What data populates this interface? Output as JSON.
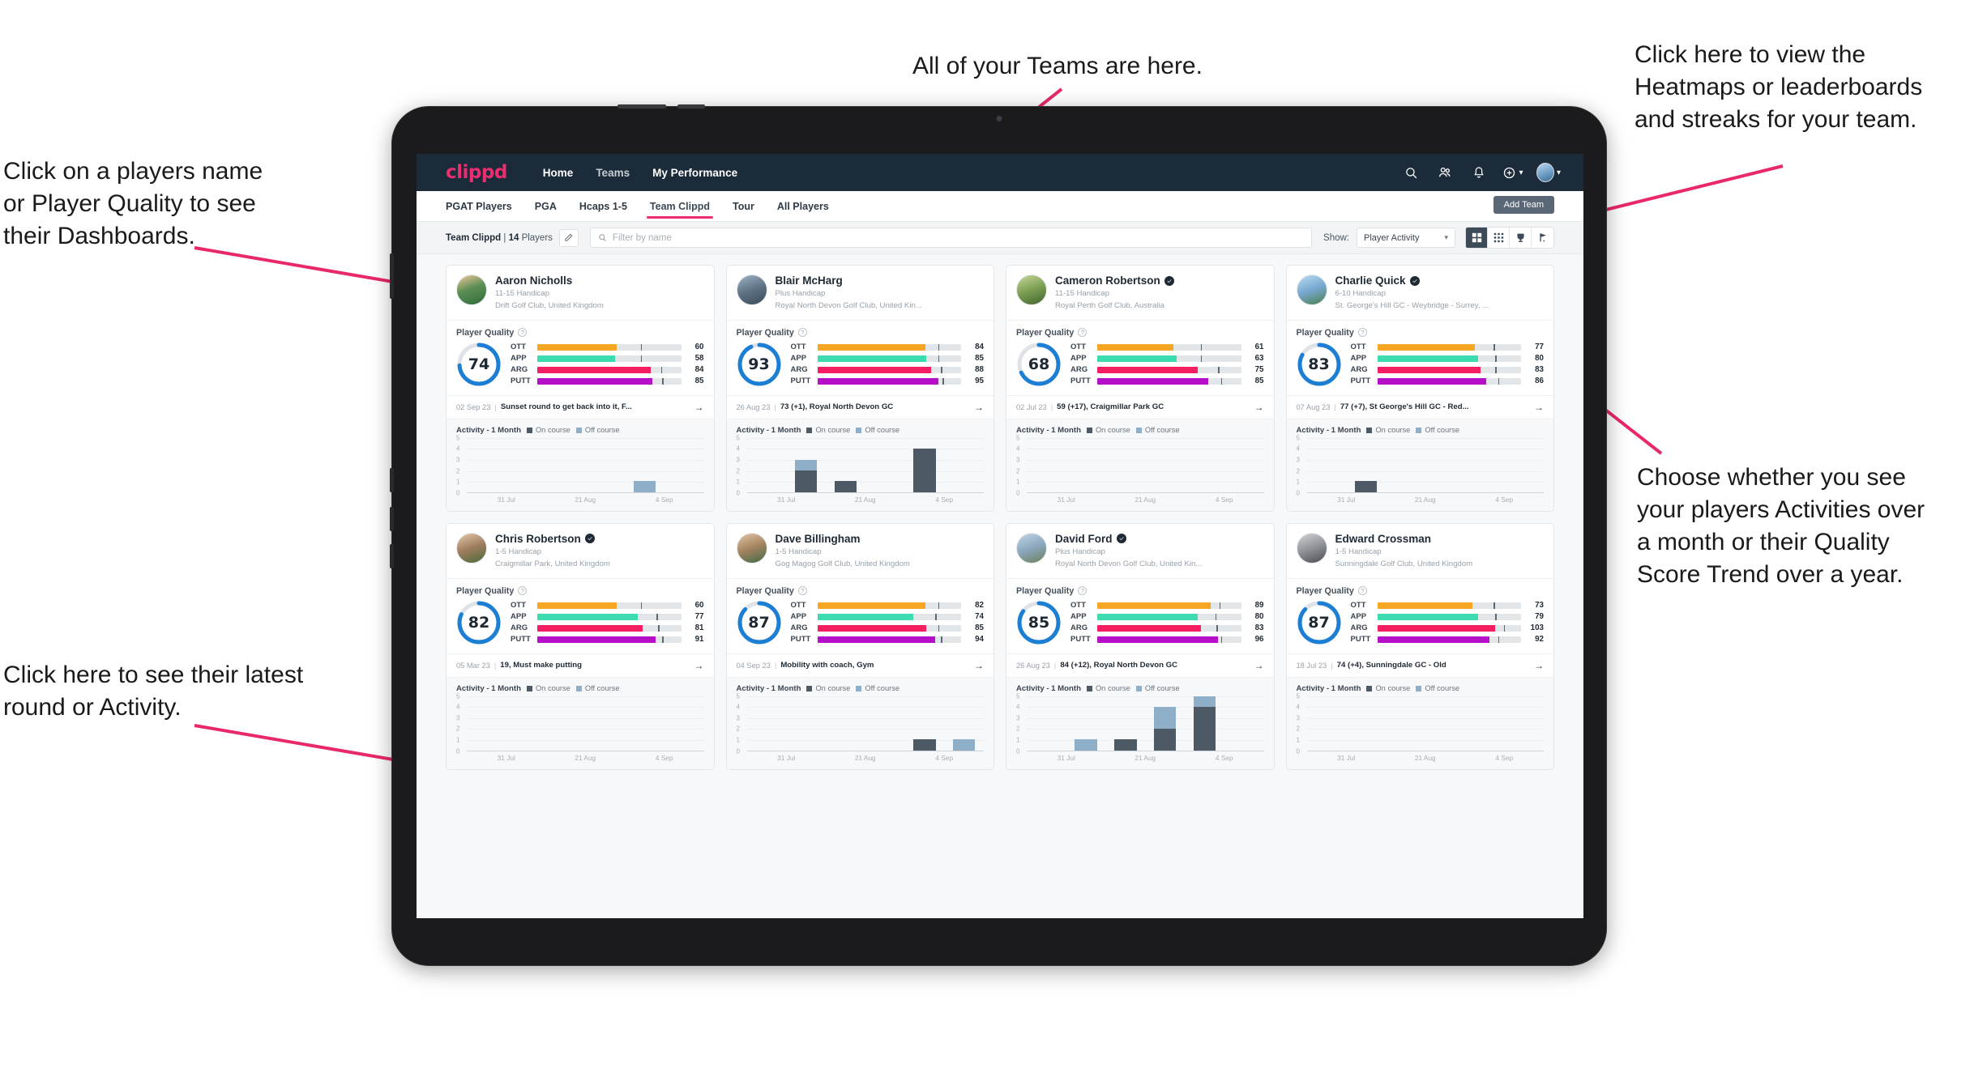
{
  "annotations": [
    {
      "id": "a-teams",
      "text": "All of your Teams are here."
    },
    {
      "id": "a-heatmaps",
      "text": "Click here to view the\nHeatmaps or leaderboards\nand streaks for your team."
    },
    {
      "id": "a-names",
      "text": "Click on a players name\nor Player Quality to see\ntheir Dashboards."
    },
    {
      "id": "a-activity",
      "text": "Choose whether you see\nyour players Activities over\na month or their Quality\nScore Trend over a year."
    },
    {
      "id": "a-latest",
      "text": "Click here to see their latest\nround or Activity."
    }
  ],
  "app": {
    "logo": "clippd",
    "nav_links": [
      {
        "label": "Home",
        "active": true
      },
      {
        "label": "Teams",
        "active": false
      },
      {
        "label": "My Performance",
        "active": true
      }
    ],
    "nav_icons": [
      "search-icon",
      "people-icon",
      "bell-icon",
      "plus-circle-icon",
      "avatar"
    ],
    "tabs": [
      {
        "label": "PGAT Players",
        "active": false
      },
      {
        "label": "PGA",
        "active": false
      },
      {
        "label": "Hcaps 1-5",
        "active": false
      },
      {
        "label": "Team Clippd",
        "active": true
      },
      {
        "label": "Tour",
        "active": false
      },
      {
        "label": "All Players",
        "active": false
      }
    ],
    "add_team_label": "Add Team",
    "toolbar": {
      "team_name": "Team Clippd",
      "team_sep": "|",
      "player_count": "14",
      "players_word": "Players",
      "edit_icon": "pencil-icon",
      "search_placeholder": "Filter by name",
      "search_value": "",
      "show_label": "Show:",
      "show_value": "Player Activity",
      "show_options": [
        "Player Activity",
        "Quality Score Trend"
      ],
      "view_buttons": [
        "dashboard-view-icon",
        "grid-view-icon",
        "trophy-view-icon",
        "course-view-icon"
      ],
      "active_view": 0
    }
  },
  "chart_data": {
    "type": "bar",
    "title": "Activity - 1 Month",
    "legend": [
      "On course",
      "Off course"
    ],
    "legend_position": "top",
    "colors": {
      "on_course": "#4d5a66",
      "off_course": "#8fafc9"
    },
    "ylim": [
      0,
      5
    ],
    "yticks": [
      5,
      4,
      3,
      2,
      1,
      0
    ],
    "xlabels": [
      "31 Jul",
      "21 Aug",
      "4 Sep"
    ],
    "n_slots": 6,
    "series_by_player": {
      "Aaron Nicholls": {
        "on_course": [
          0,
          0,
          0,
          0,
          0,
          0
        ],
        "off_course": [
          0,
          0,
          0,
          0,
          1,
          0
        ]
      },
      "Blair McHarg": {
        "on_course": [
          0,
          2,
          1,
          0,
          4,
          0
        ],
        "off_course": [
          0,
          1,
          0,
          0,
          0,
          0
        ]
      },
      "Cameron Robertson": {
        "on_course": [
          0,
          0,
          0,
          0,
          0,
          0
        ],
        "off_course": [
          0,
          0,
          0,
          0,
          0,
          0
        ]
      },
      "Charlie Quick": {
        "on_course": [
          0,
          1,
          0,
          0,
          0,
          0
        ],
        "off_course": [
          0,
          0,
          0,
          0,
          0,
          0
        ]
      },
      "Chris Robertson": {
        "on_course": [
          0,
          0,
          0,
          0,
          0,
          0
        ],
        "off_course": [
          0,
          0,
          0,
          0,
          0,
          0
        ]
      },
      "Dave Billingham": {
        "on_course": [
          0,
          0,
          0,
          0,
          1,
          0
        ],
        "off_course": [
          0,
          0,
          0,
          0,
          0,
          1
        ]
      },
      "David Ford": {
        "on_course": [
          0,
          0,
          1,
          2,
          4,
          0
        ],
        "off_course": [
          0,
          1,
          0,
          2,
          1,
          0
        ]
      },
      "Edward Crossman": {
        "on_course": [
          0,
          0,
          0,
          0,
          0,
          0
        ],
        "off_course": [
          0,
          0,
          0,
          0,
          0,
          0
        ]
      }
    }
  },
  "metric_colors": {
    "OTT": "#f5a623",
    "APP": "#3ddbb0",
    "ARG": "#f51e63",
    "PUTT": "#b510c8",
    "ring": "#1d7fd4",
    "track": "#e3e6e9"
  },
  "cards": [
    {
      "name": "Aaron Nicholls",
      "verified": false,
      "handicap": "11-15 Handicap",
      "club": "Drift Golf Club, United Kingdom",
      "pq_label": "Player Quality",
      "score": "74",
      "score_pct": 74,
      "metrics": [
        {
          "label": "OTT",
          "value": "60",
          "fill": 55,
          "tick": 72
        },
        {
          "label": "APP",
          "value": "58",
          "fill": 54,
          "tick": 72
        },
        {
          "label": "ARG",
          "value": "84",
          "fill": 79,
          "tick": 86
        },
        {
          "label": "PUTT",
          "value": "85",
          "fill": 80,
          "tick": 87
        }
      ],
      "round_date": "02 Sep 23",
      "round_text": "Sunset round to get back into it, F...",
      "activity_title": "Activity - 1 Month"
    },
    {
      "name": "Blair McHarg",
      "verified": false,
      "handicap": "Plus Handicap",
      "club": "Royal North Devon Golf Club, United Kin...",
      "pq_label": "Player Quality",
      "score": "93",
      "score_pct": 93,
      "metrics": [
        {
          "label": "OTT",
          "value": "84",
          "fill": 75,
          "tick": 84
        },
        {
          "label": "APP",
          "value": "85",
          "fill": 76,
          "tick": 84
        },
        {
          "label": "ARG",
          "value": "88",
          "fill": 79,
          "tick": 86
        },
        {
          "label": "PUTT",
          "value": "95",
          "fill": 84,
          "tick": 87
        }
      ],
      "round_date": "26 Aug 23",
      "round_text": "73 (+1), Royal North Devon GC",
      "activity_title": "Activity - 1 Month"
    },
    {
      "name": "Cameron Robertson",
      "verified": true,
      "handicap": "11-15 Handicap",
      "club": "Royal Perth Golf Club, Australia",
      "pq_label": "Player Quality",
      "score": "68",
      "score_pct": 68,
      "metrics": [
        {
          "label": "OTT",
          "value": "61",
          "fill": 53,
          "tick": 72
        },
        {
          "label": "APP",
          "value": "63",
          "fill": 55,
          "tick": 72
        },
        {
          "label": "ARG",
          "value": "75",
          "fill": 70,
          "tick": 84
        },
        {
          "label": "PUTT",
          "value": "85",
          "fill": 77,
          "tick": 86
        }
      ],
      "round_date": "02 Jul 23",
      "round_text": "59 (+17), Craigmillar Park GC",
      "activity_title": "Activity - 1 Month"
    },
    {
      "name": "Charlie Quick",
      "verified": true,
      "handicap": "6-10 Handicap",
      "club": "St. George's Hill GC - Weybridge - Surrey, ...",
      "pq_label": "Player Quality",
      "score": "83",
      "score_pct": 83,
      "metrics": [
        {
          "label": "OTT",
          "value": "77",
          "fill": 68,
          "tick": 81
        },
        {
          "label": "APP",
          "value": "80",
          "fill": 70,
          "tick": 82
        },
        {
          "label": "ARG",
          "value": "83",
          "fill": 72,
          "tick": 82
        },
        {
          "label": "PUTT",
          "value": "86",
          "fill": 76,
          "tick": 84
        }
      ],
      "round_date": "07 Aug 23",
      "round_text": "77 (+7), St George's Hill GC - Red...",
      "activity_title": "Activity - 1 Month"
    },
    {
      "name": "Chris Robertson",
      "verified": true,
      "handicap": "1-5 Handicap",
      "club": "Craigmillar Park, United Kingdom",
      "pq_label": "Player Quality",
      "score": "82",
      "score_pct": 82,
      "metrics": [
        {
          "label": "OTT",
          "value": "60",
          "fill": 55,
          "tick": 72
        },
        {
          "label": "APP",
          "value": "77",
          "fill": 70,
          "tick": 83
        },
        {
          "label": "ARG",
          "value": "81",
          "fill": 73,
          "tick": 84
        },
        {
          "label": "PUTT",
          "value": "91",
          "fill": 82,
          "tick": 87
        }
      ],
      "round_date": "05 Mar 23",
      "round_text": "19, Must make putting",
      "activity_title": "Activity - 1 Month"
    },
    {
      "name": "Dave Billingham",
      "verified": false,
      "handicap": "1-5 Handicap",
      "club": "Gog Magog Golf Club, United Kingdom",
      "pq_label": "Player Quality",
      "score": "87",
      "score_pct": 87,
      "metrics": [
        {
          "label": "OTT",
          "value": "82",
          "fill": 75,
          "tick": 84
        },
        {
          "label": "APP",
          "value": "74",
          "fill": 67,
          "tick": 82
        },
        {
          "label": "ARG",
          "value": "85",
          "fill": 76,
          "tick": 84
        },
        {
          "label": "PUTT",
          "value": "94",
          "fill": 82,
          "tick": 86
        }
      ],
      "round_date": "04 Sep 23",
      "round_text": "Mobility with coach, Gym",
      "activity_title": "Activity - 1 Month"
    },
    {
      "name": "David Ford",
      "verified": true,
      "handicap": "Plus Handicap",
      "club": "Royal North Devon Golf Club, United Kin...",
      "pq_label": "Player Quality",
      "score": "85",
      "score_pct": 85,
      "metrics": [
        {
          "label": "OTT",
          "value": "89",
          "fill": 79,
          "tick": 85
        },
        {
          "label": "APP",
          "value": "80",
          "fill": 70,
          "tick": 82
        },
        {
          "label": "ARG",
          "value": "83",
          "fill": 72,
          "tick": 83
        },
        {
          "label": "PUTT",
          "value": "96",
          "fill": 84,
          "tick": 86
        }
      ],
      "round_date": "26 Aug 23",
      "round_text": "84 (+12), Royal North Devon GC",
      "activity_title": "Activity - 1 Month"
    },
    {
      "name": "Edward Crossman",
      "verified": false,
      "handicap": "1-5 Handicap",
      "club": "Sunningdale Golf Club, United Kingdom",
      "pq_label": "Player Quality",
      "score": "87",
      "score_pct": 87,
      "metrics": [
        {
          "label": "OTT",
          "value": "73",
          "fill": 66,
          "tick": 81
        },
        {
          "label": "APP",
          "value": "79",
          "fill": 70,
          "tick": 82
        },
        {
          "label": "ARG",
          "value": "103",
          "fill": 82,
          "tick": 88
        },
        {
          "label": "PUTT",
          "value": "92",
          "fill": 78,
          "tick": 84
        }
      ],
      "round_date": "18 Jul 23",
      "round_text": "74 (+4), Sunningdale GC - Old",
      "activity_title": "Activity - 1 Month"
    }
  ]
}
